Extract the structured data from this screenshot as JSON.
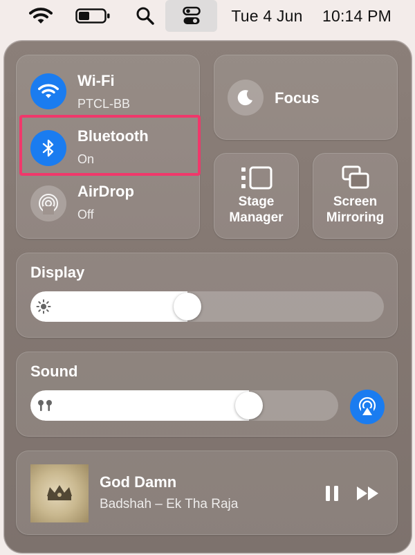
{
  "menubar": {
    "wifi_icon": "wifi-icon",
    "battery_icon": "battery-icon",
    "search_icon": "search-icon",
    "control_center_icon": "control-center-icon",
    "date": "Tue 4 Jun",
    "time": "10:14 PM"
  },
  "connectivity": {
    "wifi": {
      "title": "Wi-Fi",
      "subtitle": "PTCL-BB",
      "icon": "wifi-icon"
    },
    "bluetooth": {
      "title": "Bluetooth",
      "subtitle": "On",
      "icon": "bluetooth-icon"
    },
    "airdrop": {
      "title": "AirDrop",
      "subtitle": "Off",
      "icon": "airdrop-icon"
    }
  },
  "focus": {
    "label": "Focus",
    "icon": "moon-icon"
  },
  "stage_manager": {
    "line1": "Stage",
    "line2": "Manager",
    "icon": "stage-manager-icon"
  },
  "screen_mirroring": {
    "line1": "Screen",
    "line2": "Mirroring",
    "icon": "screen-mirroring-icon"
  },
  "display": {
    "label": "Display",
    "brightness": 0.44,
    "icon": "sun-icon"
  },
  "sound": {
    "label": "Sound",
    "volume": 0.73,
    "icon": "airpods-icon",
    "output_icon": "airplay-icon"
  },
  "now_playing": {
    "title": "God Damn",
    "artist": "Badshah – Ek Tha Raja",
    "pause_icon": "pause-icon",
    "next_icon": "forward-icon"
  },
  "colors": {
    "accent_blue": "#1a7cf0",
    "highlight": "#f0386b"
  }
}
